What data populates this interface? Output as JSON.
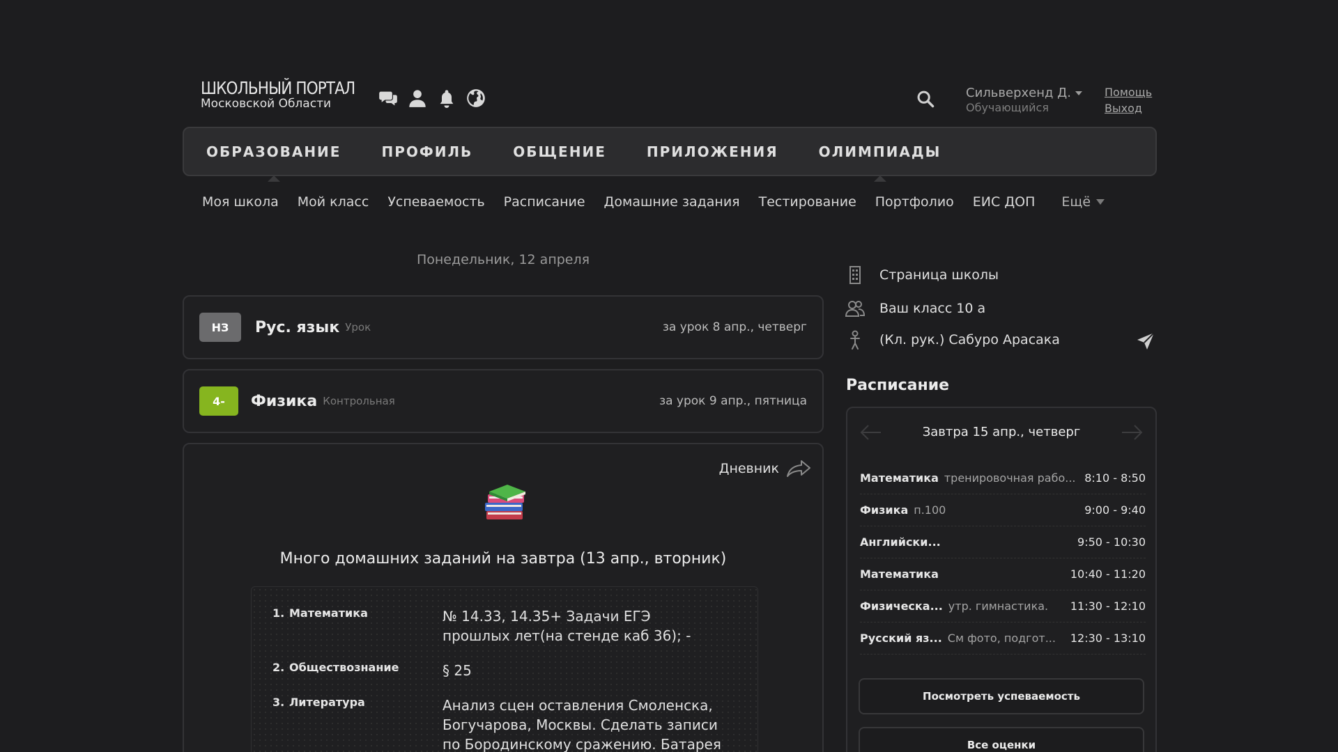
{
  "header": {
    "logo_line1": "ШКОЛЬНЫЙ ПОРТАЛ",
    "logo_line2": "Московской Области",
    "user_name": "Сильверхенд Д.",
    "user_role": "Обучающийся",
    "help": "Помощь",
    "logout": "Выход"
  },
  "main_nav": [
    "ОБРАЗОВАНИЕ",
    "ПРОФИЛЬ",
    "ОБЩЕНИЕ",
    "ПРИЛОЖЕНИЯ",
    "ОЛИМПИАДЫ"
  ],
  "sub_nav": [
    "Моя школа",
    "Мой класс",
    "Успеваемость",
    "Расписание",
    "Домашние задания",
    "Тестирование",
    "Портфолио",
    "ЕИС ДОП"
  ],
  "sub_nav_more": "Ещё",
  "date_title": "Понедельник, 12 апреля",
  "grades": [
    {
      "mark": "НЗ",
      "subject": "Рус. язык",
      "type": "Урок",
      "when": "за урок 8 апр., четверг"
    },
    {
      "mark": "4-",
      "subject": "Физика",
      "type": "Контрольная",
      "when": "за урок 9 апр., пятница"
    }
  ],
  "homework": {
    "diary_link": "Дневник",
    "title": "Много домашних заданий на завтра (13 апр., вторник)",
    "items": [
      {
        "num": "1.",
        "subject": "Математика",
        "task": "№ 14.33, 14.35+ Задачи ЕГЭ прошлых лет(на стенде каб 36); -"
      },
      {
        "num": "2.",
        "subject": "Обществознание",
        "task": "§ 25"
      },
      {
        "num": "3.",
        "subject": "Литература",
        "task": "Анализ сцен оставления Смоленска, Богучарова, Москвы. Сделать записи по Бородинскому сражению. Батарея"
      }
    ]
  },
  "right_panel": {
    "school_page": "Страница школы",
    "class": "Ваш класс 10 а",
    "teacher": "(Кл. рук.) Сабуро Арасака",
    "schedule_title": "Расписание",
    "schedule_day": "Завтра 15 апр., четверг",
    "schedule": [
      {
        "subject": "Математика",
        "note": "тренировочная рабо...",
        "time": "8:10 - 8:50"
      },
      {
        "subject": "Физика",
        "note": "п.100",
        "time": "9:00 - 9:40"
      },
      {
        "subject": "Английски...",
        "note": "",
        "time": "9:50 - 10:30"
      },
      {
        "subject": "Математика",
        "note": "",
        "time": "10:40 - 11:20"
      },
      {
        "subject": "Физическа...",
        "note": "утр. гимнастика.",
        "time": "11:30 - 12:10"
      },
      {
        "subject": "Русский яз...",
        "note": "См фото, подгот...",
        "time": "12:30 - 13:10"
      }
    ],
    "btn_performance": "Посмотреть успеваемость",
    "btn_all_grades": "Все оценки"
  },
  "colors": {
    "background": "#1d1d1f",
    "nav_bg": "#2c2c2e",
    "badge_gray": "#6b6b6d",
    "badge_green": "#86b51f"
  }
}
